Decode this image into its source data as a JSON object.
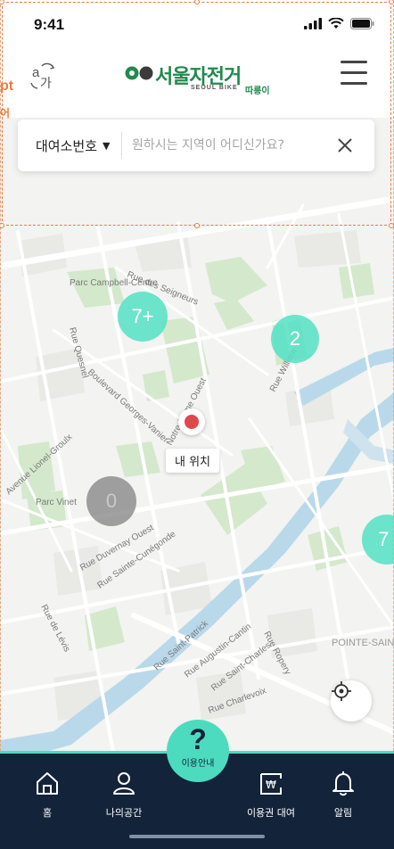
{
  "status_bar": {
    "time": "9:41"
  },
  "header": {
    "language_toggle": "language-toggle-icon",
    "logo_title": "서울자전거",
    "logo_subtitle": "SEOUL BIKE",
    "logo_subtitle2": "따릉이",
    "menu_icon": "hamburger-menu-icon"
  },
  "search": {
    "station_select_label": "대여소번호",
    "placeholder": "원하시는 지역이 어디신가요?",
    "value": ""
  },
  "selection_overlay": {
    "tag": "pt",
    "tag2": "어"
  },
  "map": {
    "street_labels": [
      "Parc Campbell-Centre",
      "Rue des Seigneurs",
      "Rue Quesnel",
      "Boulevard Georges-Vanier",
      "Rue William",
      "Avenue Lionel-Groulx",
      "Parc Vinet",
      "Rue Duvernay Ouest",
      "Rue Sainte-Cunégonde",
      "Rue de Lévis",
      "Rue Saint-Patrick",
      "Rue Augustin-Cantin",
      "Rue Saint-Charles",
      "Rue Charlevoix",
      "Rue Ropery",
      "POINTE-SAINT-CHARLES",
      "Notre-Dame Ouest"
    ],
    "clusters": [
      {
        "id": "a",
        "label": "7+"
      },
      {
        "id": "b",
        "label": "2"
      },
      {
        "id": "c",
        "label": "0"
      },
      {
        "id": "d",
        "label": "7"
      }
    ],
    "my_location_label": "내 위치"
  },
  "bottom_nav": {
    "items": [
      {
        "label": "홈",
        "icon": "home-icon"
      },
      {
        "label": "나의공간",
        "icon": "user-icon"
      },
      {
        "label": "이용권 대여",
        "icon": "ticket-won-icon"
      },
      {
        "label": "알림",
        "icon": "bell-icon"
      }
    ],
    "help": {
      "symbol": "?",
      "label": "이용안내"
    }
  },
  "colors": {
    "accent": "#4ddbbf",
    "nav_background": "#13233a",
    "brand_green": "#1f8a4c",
    "pin_red": "#e0474b",
    "water": "#b7d8ea",
    "park": "#cfe6c8"
  }
}
